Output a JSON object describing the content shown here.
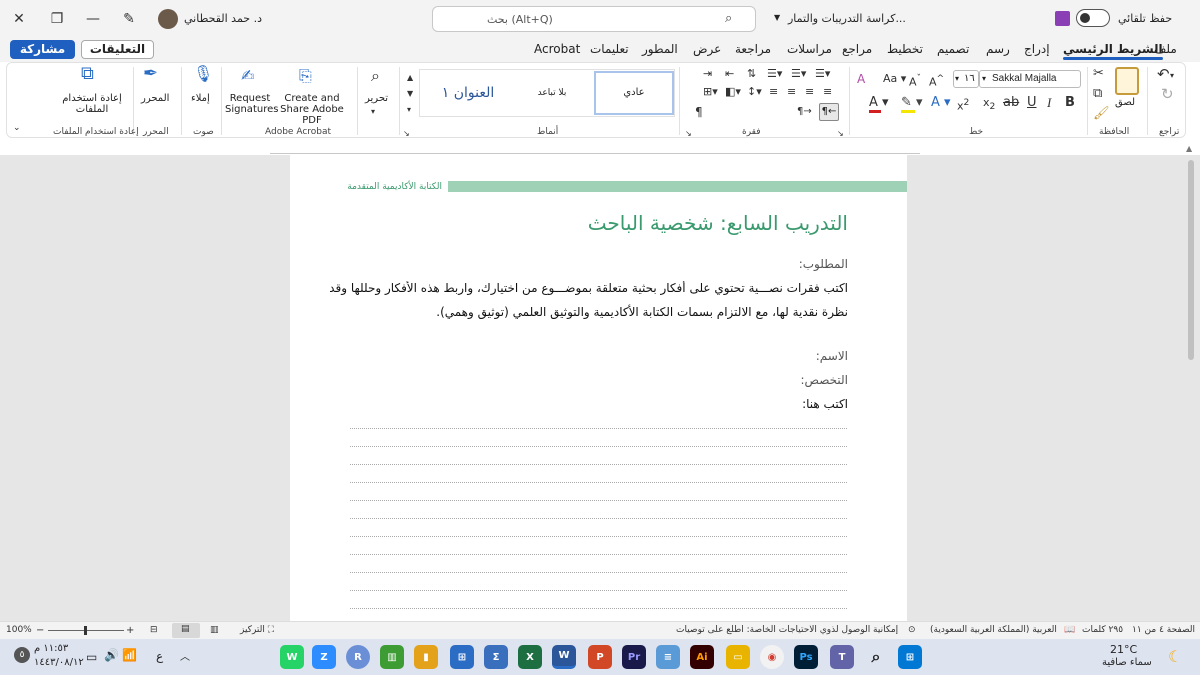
{
  "titlebar": {
    "autosave_label": "حفظ تلقائي",
    "doc_title": "كراسة التدريبات والتمار...",
    "search_placeholder": "بحث (Alt+Q)",
    "user_name": "د. حمد القحطاني"
  },
  "tabs": [
    "ملف",
    "الشريط الرئيسي",
    "إدراج",
    "رسم",
    "تصميم",
    "تخطيط",
    "مراجع",
    "مراسلات",
    "مراجعة",
    "عرض",
    "المطور",
    "تعليمات",
    "Acrobat"
  ],
  "actions": {
    "comments_label": "التعليقات",
    "share_label": "مشاركة"
  },
  "ribbon": {
    "undo_label": "تراجع",
    "clipboard_label": "الحافظة",
    "paste_label": "لصق",
    "font_label": "خط",
    "font_name": "Sakkal Majalla",
    "font_size": "١٦",
    "paragraph_label": "فقرة",
    "styles_label": "أنماط",
    "styles": [
      "عادي",
      "بلا تباعد",
      "العنوان ١"
    ],
    "editing_label": "تحرير",
    "adobe_label": "Adobe Acrobat",
    "create_share_label": "Create and Share Adobe PDF",
    "request_sig_label": "Request Signatures",
    "voice_label": "صوت",
    "dictate_label": "إملاء",
    "editor_group_label": "المحرر",
    "editor_label": "المحرر",
    "reuse_group_label": "إعادة استخدام الملفات",
    "reuse_label": "إعادة استخدام الملفات"
  },
  "document": {
    "header_text": "الكتابة الأكاديمية المتقدمة",
    "title": "التدريب السابع: شخصية الباحث",
    "required_label": "المطلوب:",
    "body_line1": "اكتب فقرات نصـــية تحتوي على أفكار بحثية متعلقة بموضـــوع من اختيارك، واربط هذه الأفكار وحللها وقدم",
    "body_line2": "نظرة نقدية لها، مع الالتزام بسمات الكتابة الأكاديمية والتوثيق العلمي (توثيق وهمي).",
    "name_label": "الاسم:",
    "specialty_label": "التخصص:",
    "write_here_label": "اكتب هنا:"
  },
  "statusbar": {
    "page_info": "الصفحة ٤ من ١١",
    "word_count": "٢٩٥ كلمات",
    "language": "العربية (المملكة العربية السعودية)",
    "accessibility": "إمكانية الوصول لذوي الاحتياجات الخاصة: اطلع على توصيات",
    "focus_label": "التركيز",
    "zoom": "100%"
  },
  "taskbar": {
    "temperature": "21°C",
    "weather": "سماء صافية",
    "time": "١١:٥٣ م",
    "date": "١٤٤٣/٠٨/١٢",
    "lang_indicator": "ع"
  },
  "colors": {
    "accent": "#1f5fbf",
    "doc_green": "#3a9a6e",
    "header_bar": "#9fd1b6",
    "word_blue": "#2b579a"
  }
}
